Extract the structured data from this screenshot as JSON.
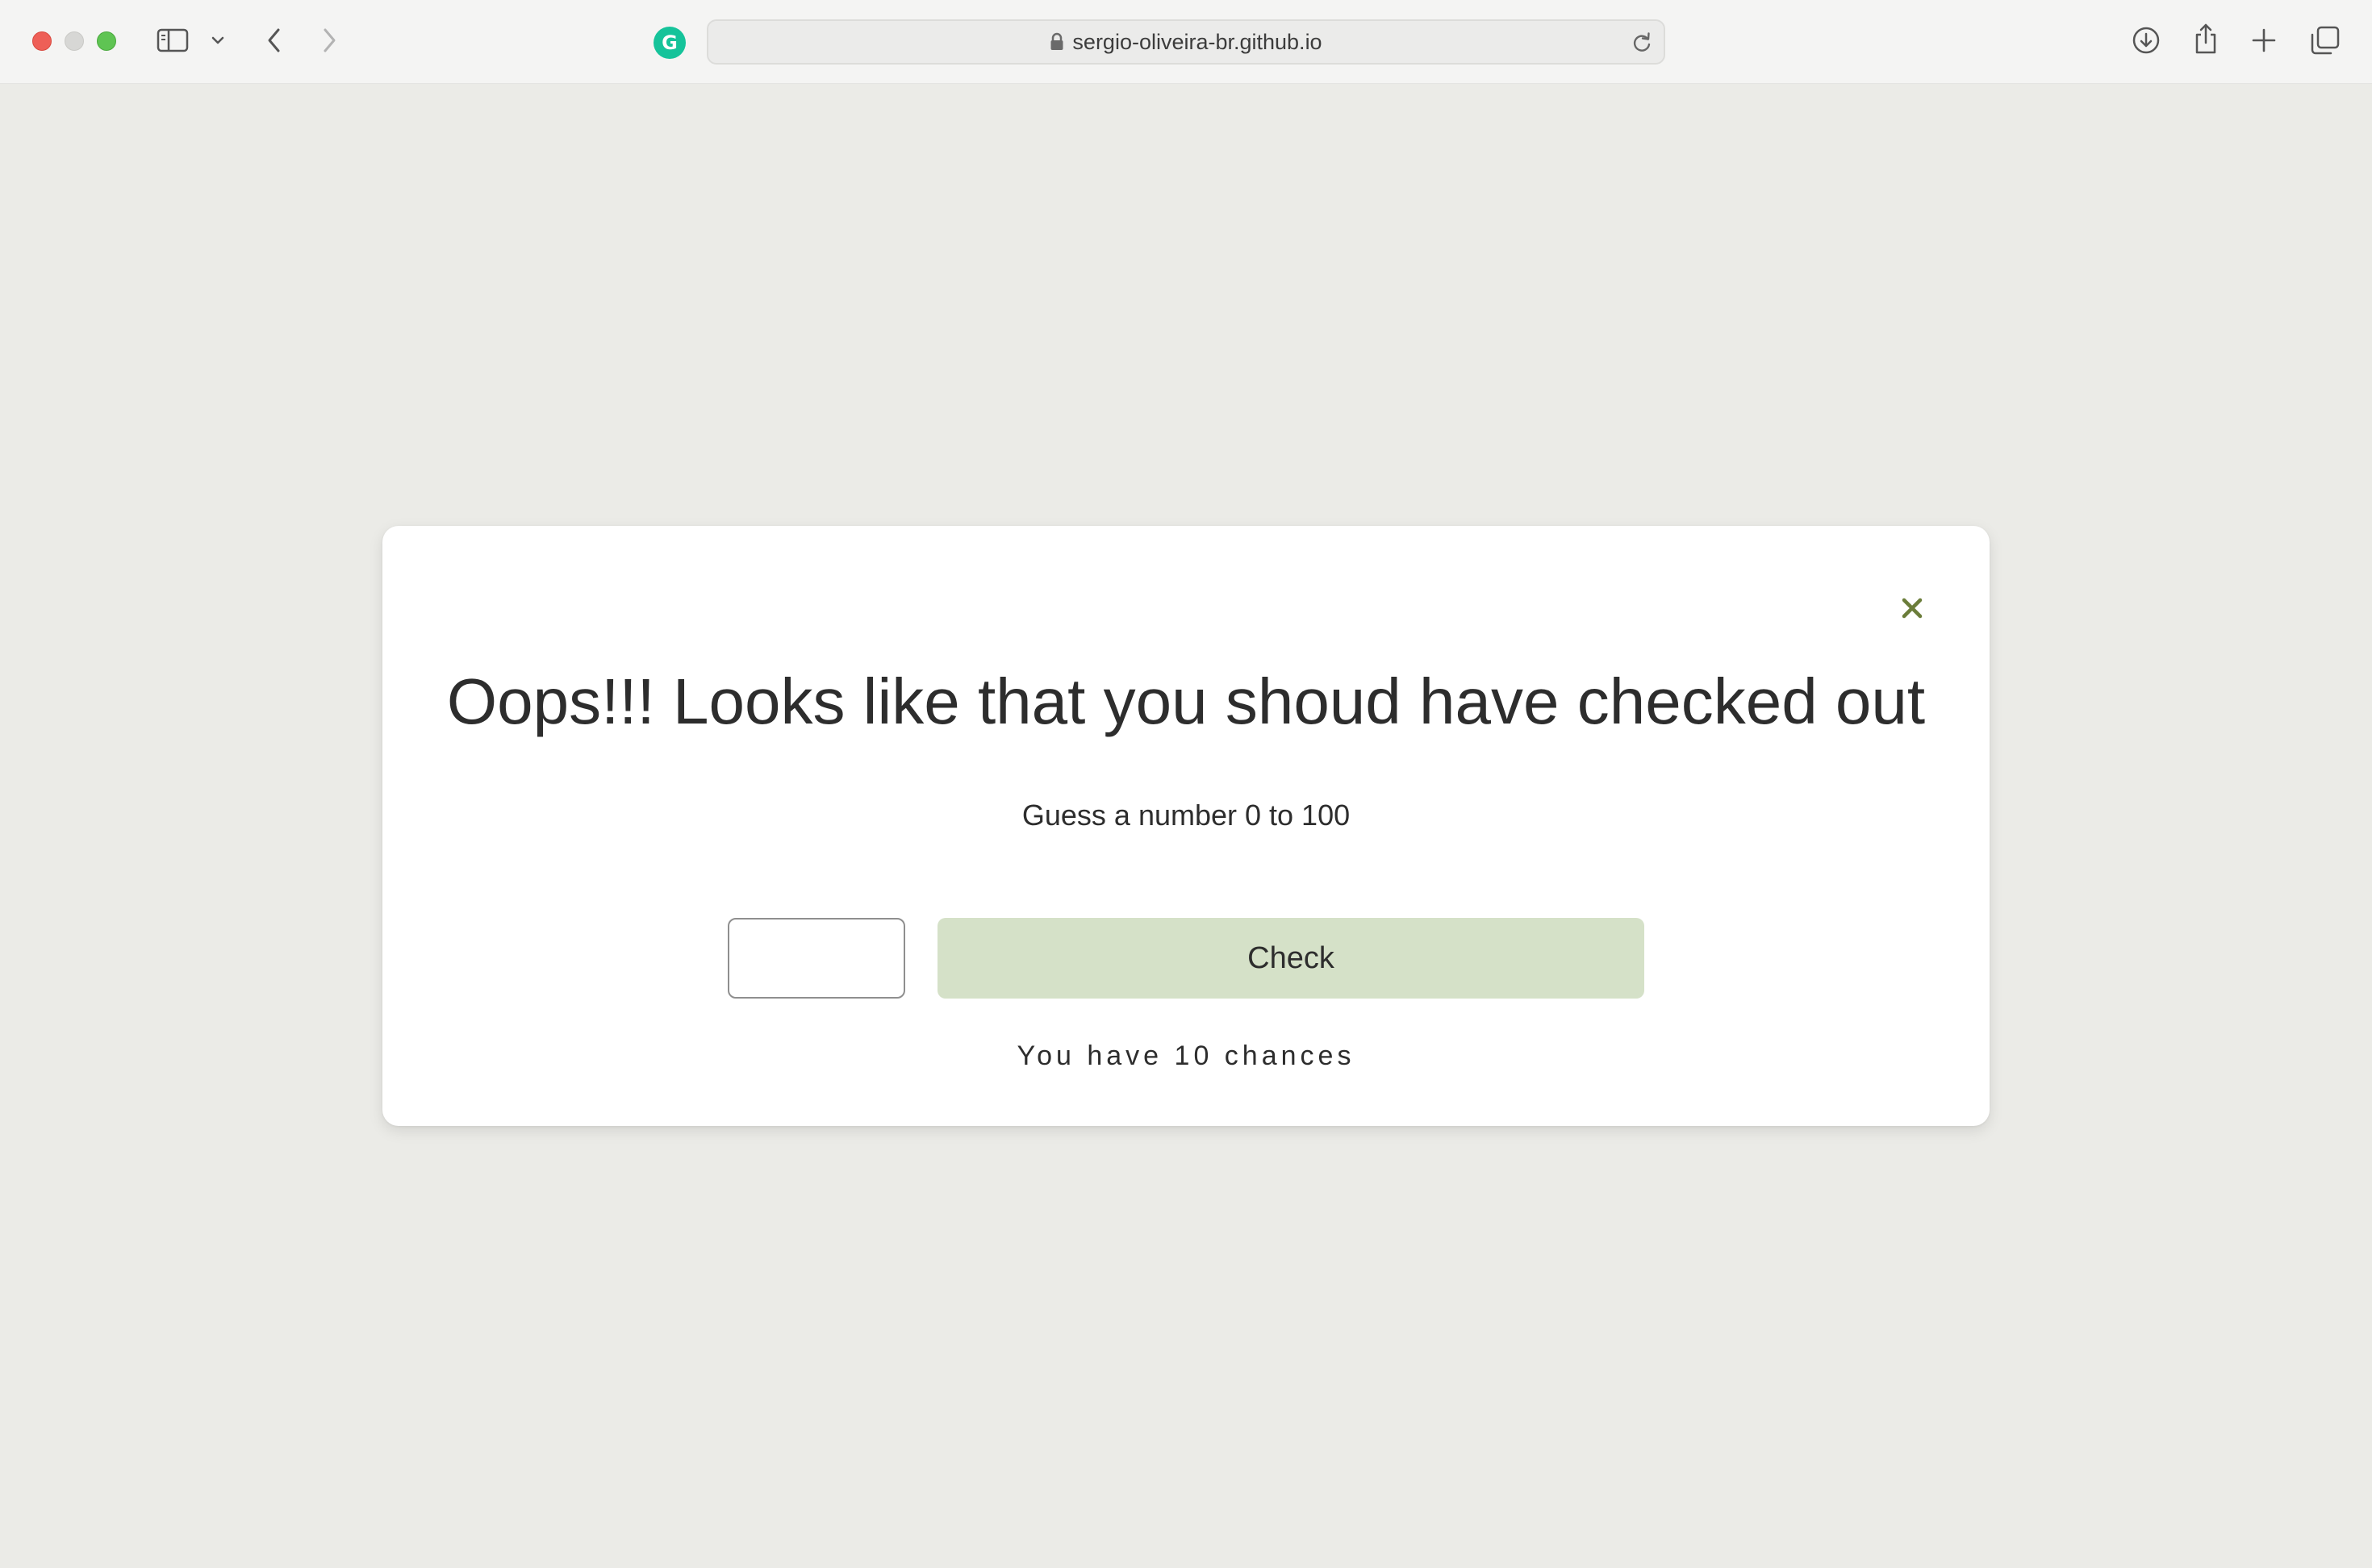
{
  "browser": {
    "url": "sergio-oliveira-br.github.io",
    "extension_badge": "G",
    "icons": {
      "sidebar": "sidebar-icon",
      "tab_group_menu": "chevron-down-icon",
      "back": "chevron-left-icon",
      "forward": "chevron-right-icon",
      "extension": "grammarly-icon",
      "lock": "lock-icon",
      "reload": "reload-icon",
      "downloads": "download-icon",
      "share": "share-icon",
      "new_tab": "plus-icon",
      "tab_overview": "tabs-overview-icon"
    }
  },
  "modal": {
    "close_icon": "close-icon",
    "title": "Oops!!! Looks like that you shoud have checked out",
    "subtitle": "Guess a number 0 to 100",
    "input_value": "",
    "check_label": "Check",
    "chances_text": "You have 10 chances"
  },
  "colors": {
    "page_background": "#ebebe7",
    "modal_background": "#ffffff",
    "check_button": "#d5e1c8",
    "close_icon": "#6b7d3a",
    "text": "#2d2d2d"
  }
}
